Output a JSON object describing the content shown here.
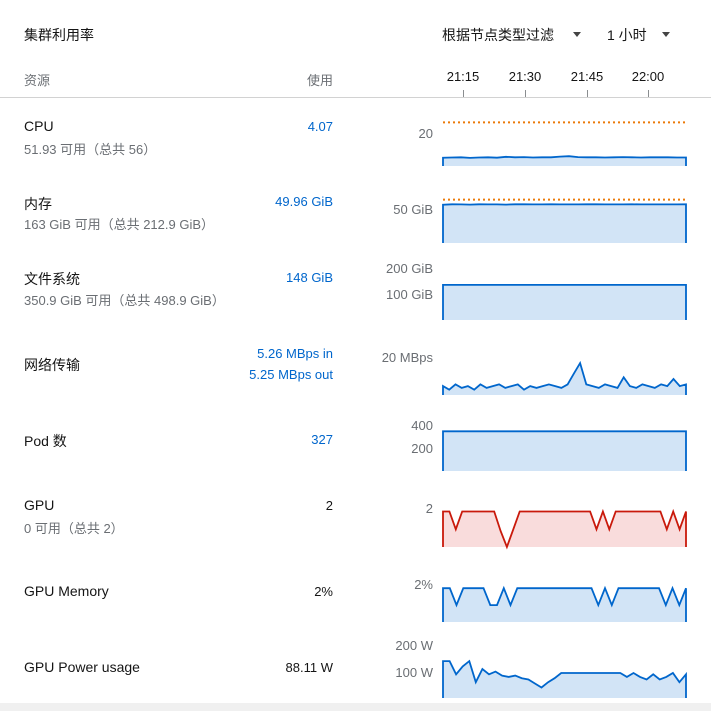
{
  "header": {
    "title": "集群利用率",
    "filter_label": "根据节点类型过滤",
    "range_label": "1 小时"
  },
  "columns": {
    "resource": "资源",
    "usage": "使用"
  },
  "time_labels": [
    "21:15",
    "21:30",
    "21:45",
    "22:00"
  ],
  "colors": {
    "link": "#0066cc",
    "line_blue": "#0066cc",
    "fill_blue": "#d2e4f6",
    "threshold": "#ec7a08",
    "line_red": "#c9190b",
    "fill_red": "#f9dcdc"
  },
  "rows": {
    "cpu": {
      "name": "CPU",
      "sub": "51.93 可用（总共 56）",
      "value": "4.07",
      "axis": [
        "20"
      ]
    },
    "memory": {
      "name": "内存",
      "sub": "163 GiB 可用（总共 212.9 GiB）",
      "value": "49.96 GiB",
      "axis": [
        "50 GiB"
      ]
    },
    "filesystem": {
      "name": "文件系统",
      "sub": "350.9 GiB 可用（总共 498.9 GiB）",
      "value": "148 GiB",
      "axis": [
        "200 GiB",
        "100 GiB"
      ]
    },
    "network": {
      "name": "网络传输",
      "value_in": "5.26 MBps in",
      "value_out": "5.25 MBps out",
      "axis": [
        "20 MBps"
      ]
    },
    "pods": {
      "name": "Pod 数",
      "value": "327",
      "axis": [
        "400",
        "200"
      ]
    },
    "gpu": {
      "name": "GPU",
      "sub": "0 可用（总共 2）",
      "value": "2",
      "axis": [
        "2"
      ]
    },
    "gpu_memory": {
      "name": "GPU Memory",
      "value": "2%",
      "axis": [
        "2%"
      ]
    },
    "gpu_power": {
      "name": "GPU Power usage",
      "value": "88.11 W",
      "axis": [
        "200 W",
        "100 W"
      ]
    }
  },
  "chart_data": [
    {
      "type": "area",
      "series": "CPU usage",
      "y": [
        3.8,
        3.9,
        4.0,
        3.7,
        3.9,
        4.0,
        3.8,
        4.2,
        4.0,
        4.1,
        3.9,
        4.0,
        4.0,
        4.3,
        4.5,
        4.1,
        4.0,
        4.0,
        3.9,
        4.0,
        4.1,
        4.0,
        3.9,
        4.0,
        4.0,
        4.0,
        3.9,
        3.9
      ],
      "ymax": 22,
      "threshold": 20
    },
    {
      "type": "area",
      "series": "Memory usage",
      "y": [
        49.5,
        50,
        49.9,
        49.6,
        50,
        49.9,
        49.8,
        49.6,
        50,
        50,
        49.9,
        49.8,
        50,
        49.9,
        49.9,
        49.9,
        50,
        50,
        49.9,
        49.9,
        49.8,
        50,
        49.9,
        49.9,
        49.9,
        49.9,
        49.9,
        50
      ],
      "ymax": 62,
      "threshold": 56
    },
    {
      "type": "area",
      "series": "Filesystem usage",
      "y": [
        148,
        148,
        148,
        148,
        148,
        148,
        148,
        148,
        148,
        148,
        148,
        148,
        148,
        148,
        148,
        148,
        148,
        148,
        148,
        148,
        148,
        148,
        148,
        148,
        148,
        148,
        148,
        148
      ],
      "ymax": 240
    },
    {
      "type": "area",
      "series": "Network in",
      "y": [
        5,
        3,
        6,
        4,
        5,
        3,
        6,
        4,
        5,
        6,
        4,
        5,
        6,
        3,
        5,
        4,
        5,
        6,
        5,
        4,
        6,
        12,
        18,
        6,
        5,
        4,
        6,
        5,
        4,
        10,
        5,
        4,
        6,
        5,
        4,
        6,
        5,
        9,
        5,
        6
      ],
      "ymax": 22
    },
    {
      "type": "area",
      "series": "Pod count",
      "y": [
        327,
        327,
        327,
        327,
        327,
        327,
        327,
        327,
        327,
        327,
        327,
        327,
        327,
        327,
        327,
        327,
        327,
        327,
        327,
        327,
        327,
        327,
        327,
        327,
        327,
        327,
        327,
        327
      ],
      "ymax": 420
    },
    {
      "type": "area",
      "series": "GPU",
      "y": [
        2,
        2,
        1,
        2,
        2,
        2,
        2,
        2,
        2,
        0.9,
        0,
        1.0,
        2,
        2,
        2,
        2,
        2,
        2,
        2,
        2,
        2,
        2,
        2,
        2,
        1,
        2,
        1,
        2,
        2,
        2,
        2,
        2,
        2,
        2,
        2,
        1,
        2,
        1,
        2
      ],
      "ymax": 2.2
    },
    {
      "type": "area",
      "series": "GPU Memory",
      "y": [
        2,
        2,
        1,
        2,
        2,
        2,
        2,
        1,
        1,
        2,
        1,
        2,
        2,
        2,
        2,
        2,
        2,
        2,
        2,
        2,
        2,
        2,
        2,
        1,
        2,
        1,
        2,
        2,
        2,
        2,
        2,
        2,
        2,
        1,
        2,
        1,
        2
      ],
      "ymax": 2.6
    },
    {
      "type": "area",
      "series": "GPU Power",
      "y": [
        140,
        140,
        90,
        120,
        140,
        60,
        110,
        90,
        100,
        85,
        80,
        85,
        75,
        70,
        55,
        40,
        60,
        75,
        95,
        95,
        95,
        95,
        95,
        95,
        95,
        95,
        95,
        95,
        80,
        95,
        80,
        70,
        90,
        70,
        80,
        95,
        60,
        90
      ],
      "ymax": 220
    }
  ]
}
